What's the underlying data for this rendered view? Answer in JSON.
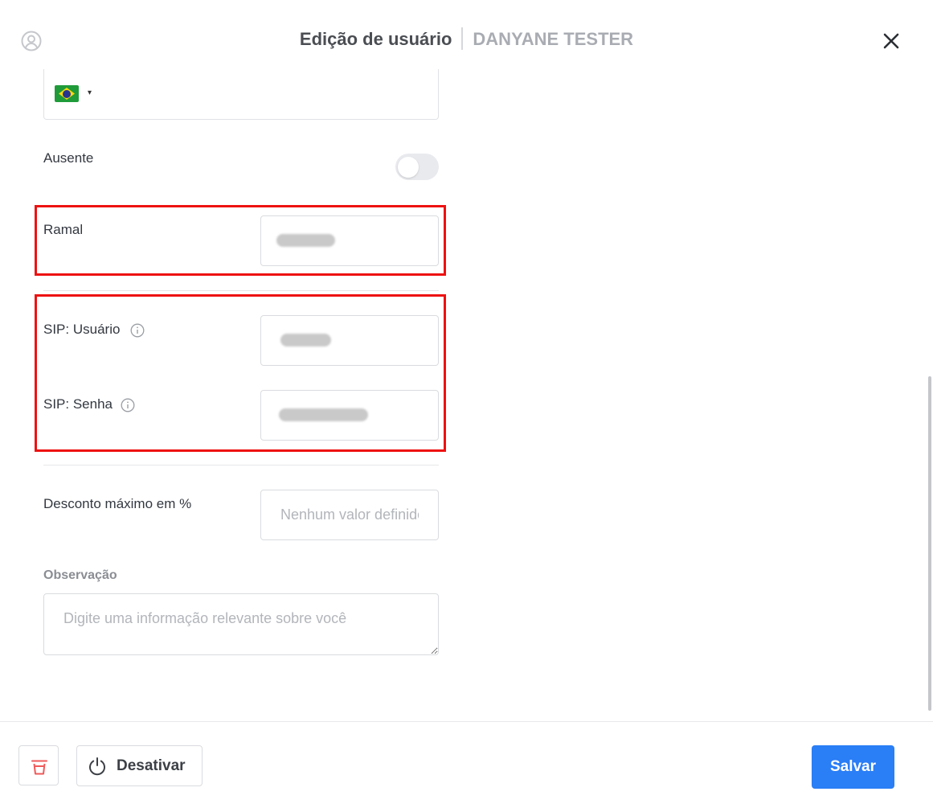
{
  "header": {
    "title": "Edição de usuário",
    "user_name": "DANYANE TESTER"
  },
  "phone": {
    "country_flag": "brazil-flag",
    "caret": "▾"
  },
  "fields": {
    "absent_label": "Ausente",
    "absent_on": false,
    "extension_label": "Ramal",
    "sip_user_label": "SIP: Usuário",
    "sip_password_label": "SIP: Senha",
    "max_discount_label": "Desconto máximo em %",
    "max_discount_placeholder": "Nenhum valor definido",
    "observation_label": "Observação",
    "observation_placeholder": "Digite uma informação relevante sobre você"
  },
  "footer": {
    "deactivate_label": "Desativar",
    "save_label": "Salvar"
  },
  "colors": {
    "primary": "#2a7ef6",
    "highlight": "#ee1111",
    "delete_icon": "#ef5a5a"
  }
}
